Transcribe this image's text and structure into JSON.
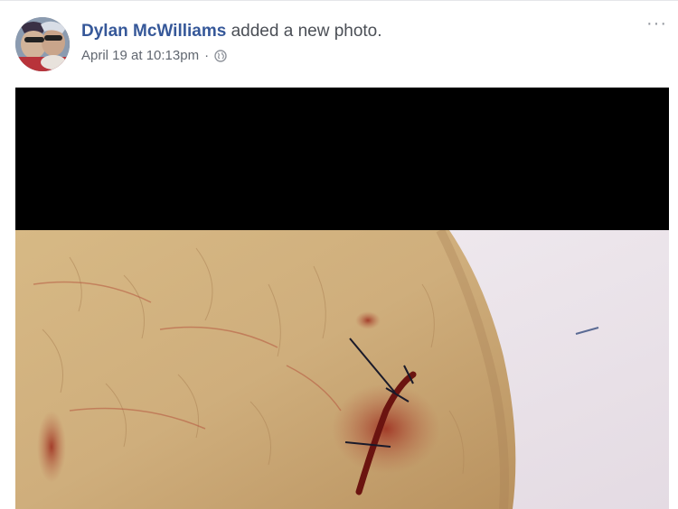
{
  "post": {
    "author": "Dylan McWilliams",
    "action": "added a new photo.",
    "timestamp": "April 19 at 10:13pm",
    "separator": "·",
    "privacy_icon": "globe-icon",
    "more_label": "···"
  },
  "photo": {
    "description_icon": "post-photo"
  },
  "colors": {
    "author_link": "#365899",
    "meta_text": "#616770",
    "body_text": "#4b4f56"
  }
}
